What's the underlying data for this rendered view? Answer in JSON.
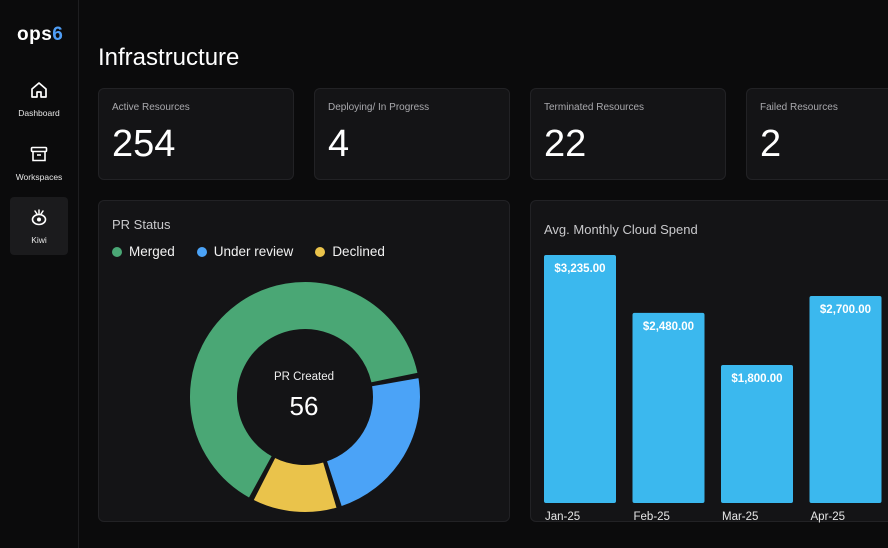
{
  "app": {
    "logo_text": "ops",
    "logo_accent": "6"
  },
  "sidebar": {
    "items": [
      {
        "label": "Dashboard",
        "icon": "home-icon"
      },
      {
        "label": "Workspaces",
        "icon": "archive-icon"
      },
      {
        "label": "Kiwi",
        "icon": "kiwi-icon",
        "active": true
      }
    ]
  },
  "page": {
    "title": "Infrastructure"
  },
  "stats": [
    {
      "label": "Active Resources",
      "value": "254"
    },
    {
      "label": "Deploying/ In Progress",
      "value": "4"
    },
    {
      "label": "Terminated Resources",
      "value": "22"
    },
    {
      "label": "Failed Resources",
      "value": "2"
    }
  ],
  "pr_status": {
    "title": "PR Status",
    "legend": [
      {
        "label": "Merged",
        "color": "#4aa775"
      },
      {
        "label": "Under review",
        "color": "#4ba3f7"
      },
      {
        "label": "Declined",
        "color": "#eac34b"
      }
    ],
    "center_label": "PR Created",
    "center_value": "56"
  },
  "spend": {
    "title": "Avg. Monthly Cloud Spend"
  },
  "chart_data": [
    {
      "type": "pie",
      "title": "PR Status",
      "categories": [
        "Merged",
        "Under review",
        "Declined"
      ],
      "values": [
        36,
        13,
        7
      ],
      "colors": [
        "#4aa775",
        "#4ba3f7",
        "#eac34b"
      ],
      "center_label": "PR Created",
      "center_value": 56
    },
    {
      "type": "bar",
      "title": "Avg. Monthly Cloud Spend",
      "categories": [
        "Jan-25",
        "Feb-25",
        "Mar-25",
        "Apr-25"
      ],
      "values": [
        3235,
        2480,
        1800,
        2700
      ],
      "value_labels": [
        "$3,235.00",
        "$2,480.00",
        "$1,800.00",
        "$2,700.00"
      ],
      "color": "#3bb8ee"
    }
  ]
}
